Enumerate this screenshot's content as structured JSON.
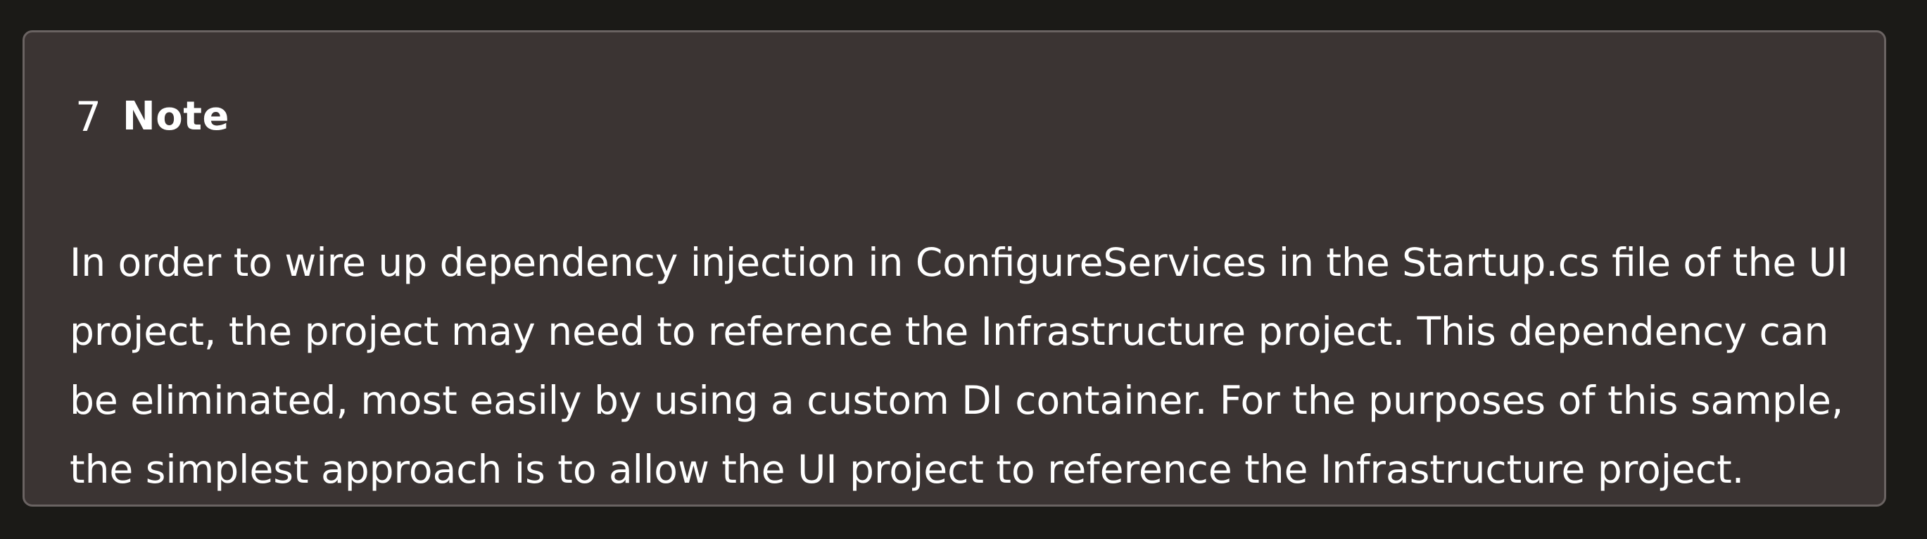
{
  "note": {
    "icon": "7",
    "title": "Note",
    "lines": [
      "In order to wire up dependency injection in ConfigureServices in the Startup.cs file of the UI",
      "project, the project may need to reference the Infrastructure project. This dependency can",
      "be eliminated, most easily by using a custom DI container. For the purposes of this sample,",
      "the simplest approach is to allow the UI project to reference the Infrastructure project."
    ]
  }
}
